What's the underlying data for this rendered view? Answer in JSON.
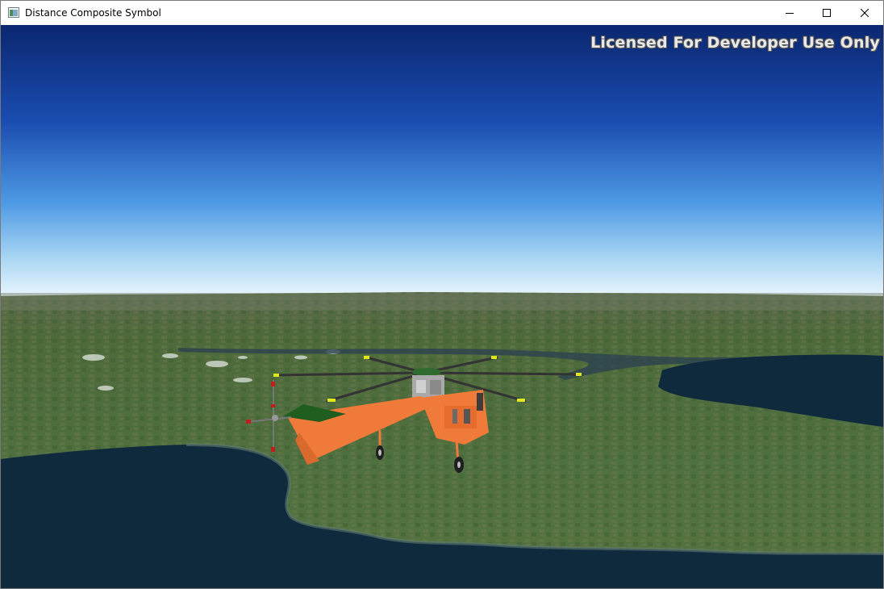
{
  "window": {
    "title": "Distance Composite Symbol",
    "controls": [
      "minimize",
      "maximize",
      "close"
    ]
  },
  "scene": {
    "watermark": "Licensed For Developer Use Only",
    "sky_top_color": "#0c2a78",
    "sky_horizon_color": "#e6f3fb",
    "land_color": "#4d6a3a",
    "water_color": "#0f2a3c",
    "model": "helicopter-icon",
    "model_color": "#f07a3a"
  }
}
